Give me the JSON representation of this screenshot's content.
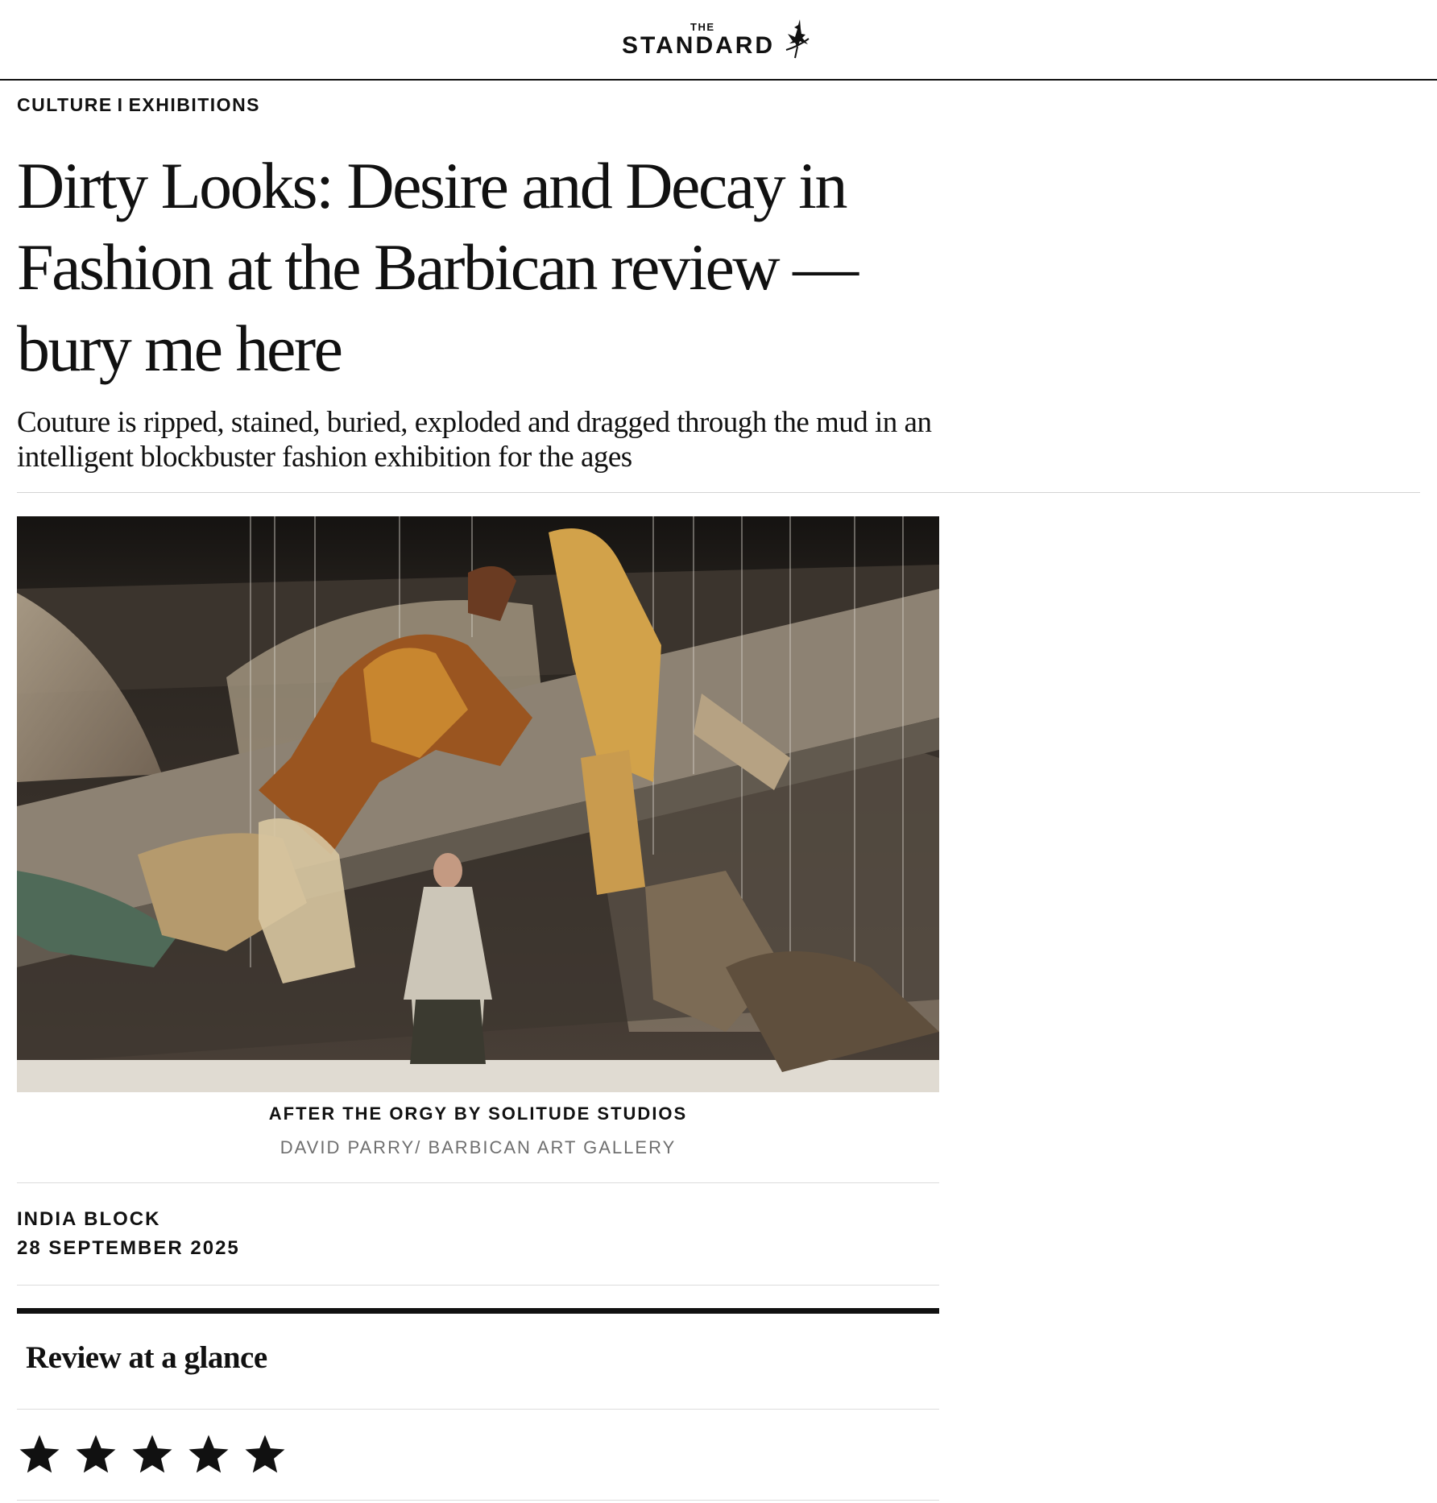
{
  "masthead": {
    "logo_small": "THE",
    "logo_main": "STANDARD",
    "logo_icon": "eros-figure-icon"
  },
  "breadcrumb": {
    "section": "CULTURE",
    "separator": "I",
    "subsection": "EXHIBITIONS"
  },
  "article": {
    "headline": "Dirty Looks: Desire and Decay in Fashion at the Barbican review — bury me here",
    "standfirst": "Couture is ripped, stained, buried, exploded and dragged through the mud in an intelligent blockbuster fashion exhibition for the ages",
    "image": {
      "caption": "AFTER THE ORGY BY SOLITUDE STUDIOS",
      "credit": "DAVID PARRY/ BARBICAN ART GALLERY"
    },
    "author": "INDIA BLOCK",
    "date": "28 SEPTEMBER 2025"
  },
  "review_box": {
    "title": "Review at a glance",
    "rating": 5,
    "rating_max": 5,
    "star_icon": "star-icon"
  },
  "colors": {
    "text": "#111111",
    "rule": "#d4d4d4",
    "credit": "#6f6f6f"
  }
}
